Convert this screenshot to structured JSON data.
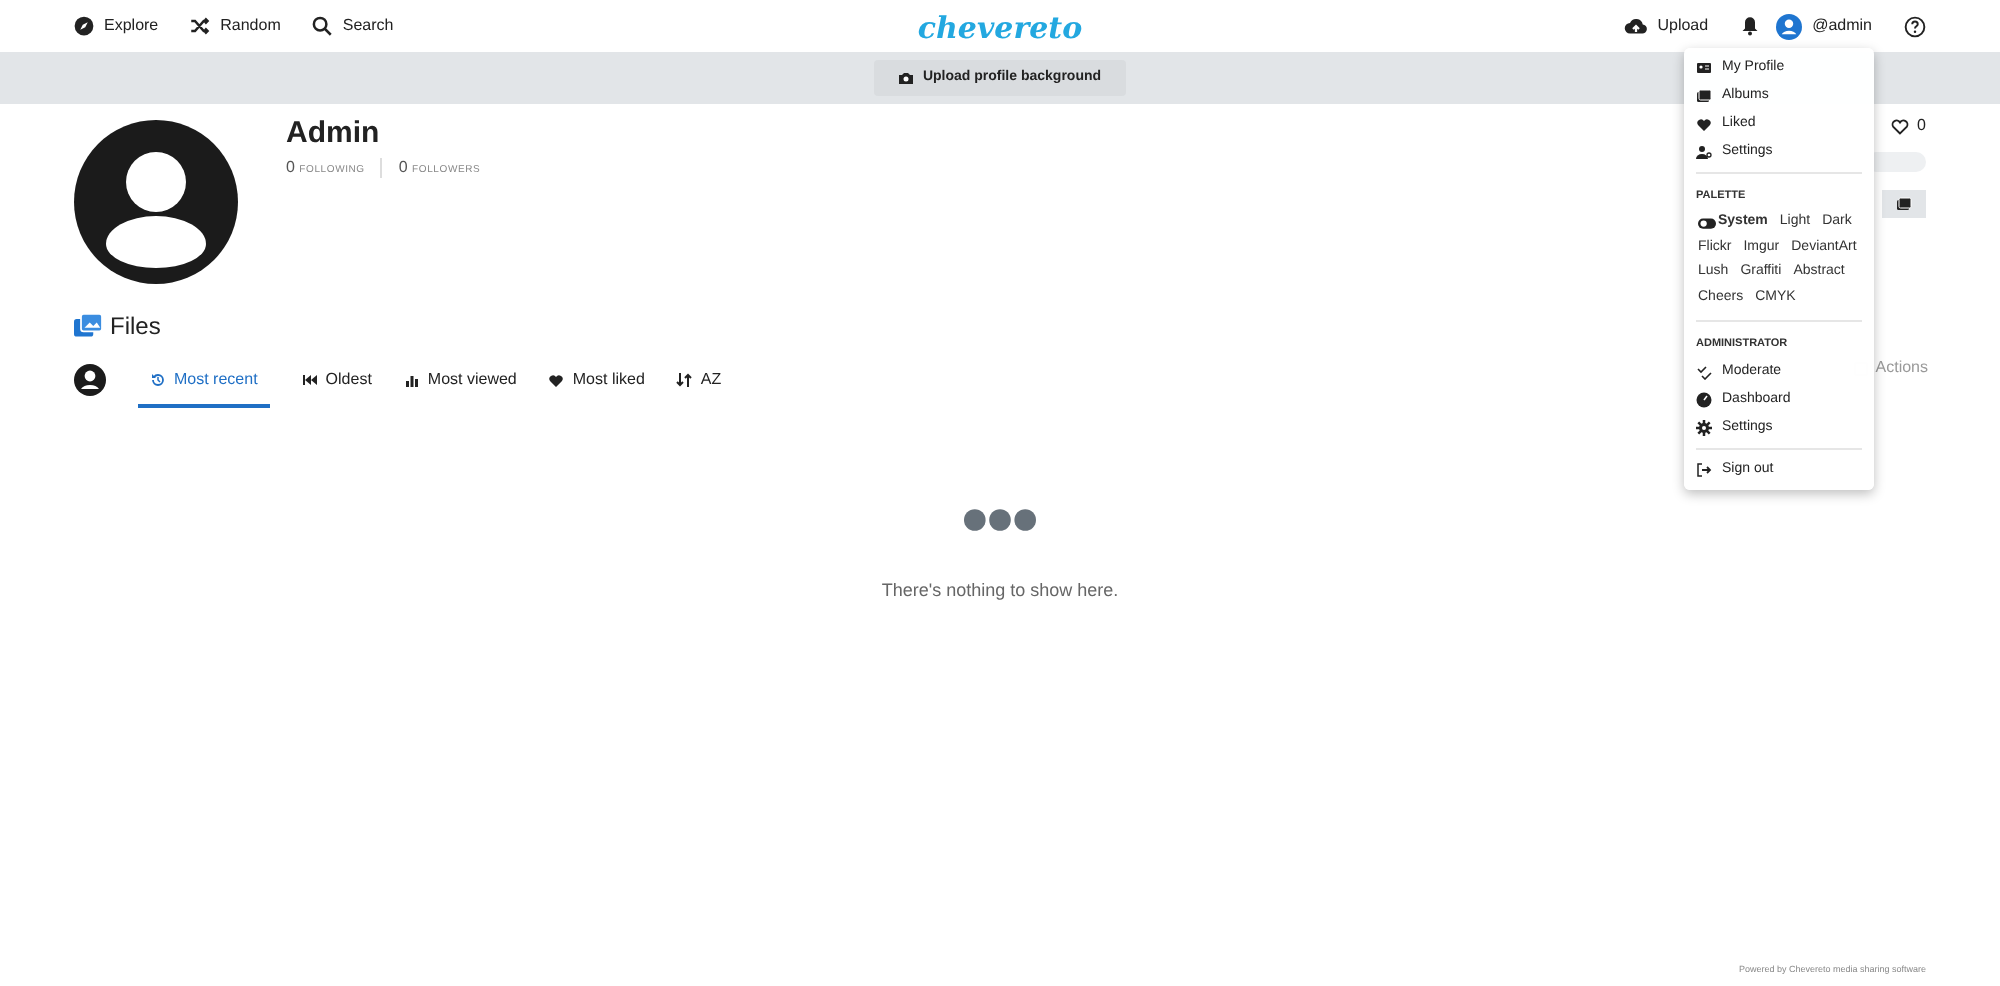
{
  "nav": {
    "links": [
      {
        "label": "Explore"
      },
      {
        "label": "Random"
      },
      {
        "label": "Search"
      }
    ],
    "logo": "chevereto",
    "upload": "Upload",
    "user": "@admin"
  },
  "banner": {
    "button": "Upload profile background"
  },
  "profile": {
    "name": "Admin",
    "stats": [
      {
        "count": "0",
        "label": "FOLLOWING"
      },
      {
        "count": "0",
        "label": "FOLLOWERS"
      }
    ],
    "likes": "0",
    "actions": "Actions"
  },
  "files": {
    "title": "Files",
    "tabs": [
      {
        "label": "Most recent",
        "selected": true
      },
      {
        "label": "Oldest",
        "selected": false
      },
      {
        "label": "Most viewed",
        "selected": false
      },
      {
        "label": "Most liked",
        "selected": false
      },
      {
        "label": "AZ",
        "selected": false
      }
    ],
    "empty": "There's nothing to show here."
  },
  "menu": {
    "items": [
      {
        "label": "My Profile"
      },
      {
        "label": "Albums"
      },
      {
        "label": "Liked"
      },
      {
        "label": "Settings"
      }
    ],
    "palette_title": "PALETTE",
    "palettes": [
      {
        "label": "System",
        "selected": true
      },
      {
        "label": "Light",
        "selected": false
      },
      {
        "label": "Dark",
        "selected": false
      },
      {
        "label": "Flickr",
        "selected": false
      },
      {
        "label": "Imgur",
        "selected": false
      },
      {
        "label": "DeviantArt",
        "selected": false
      },
      {
        "label": "Lush",
        "selected": false
      },
      {
        "label": "Graffiti",
        "selected": false
      },
      {
        "label": "Abstract",
        "selected": false
      },
      {
        "label": "Cheers",
        "selected": false
      },
      {
        "label": "CMYK",
        "selected": false
      }
    ],
    "admin_title": "ADMINISTRATOR",
    "admin_items": [
      {
        "label": "Moderate"
      },
      {
        "label": "Dashboard"
      },
      {
        "label": "Settings"
      }
    ],
    "signout": "Sign out"
  },
  "footer": "Powered by Chevereto media sharing software"
}
